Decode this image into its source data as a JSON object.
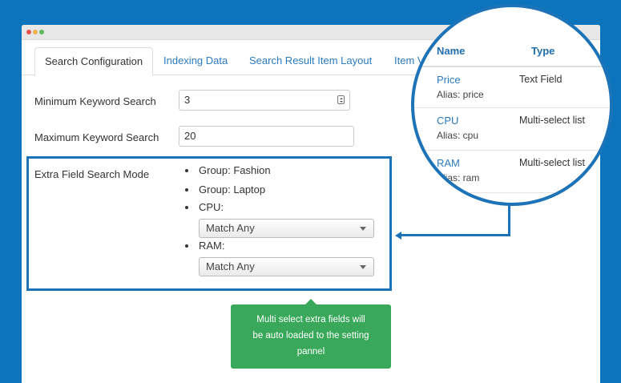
{
  "window": {
    "tabs": [
      {
        "label": "Search Configuration",
        "active": true
      },
      {
        "label": "Indexing Data",
        "active": false
      },
      {
        "label": "Search Result Item Layout",
        "active": false
      },
      {
        "label": "Item V",
        "active": false
      }
    ]
  },
  "form": {
    "min_keyword": {
      "label": "Minimum Keyword Search",
      "value": "3",
      "icon": "spinner-icon"
    },
    "max_keyword": {
      "label": "Maximum Keyword Search",
      "value": "20"
    },
    "extra_field_mode": {
      "label": "Extra Field Search Mode",
      "items": [
        {
          "text": "Group: Fashion"
        },
        {
          "text": "Group: Laptop"
        },
        {
          "text": "CPU:",
          "select": "Match Any"
        },
        {
          "text": "RAM:",
          "select": "Match Any"
        }
      ]
    }
  },
  "tooltip": {
    "text_line1": "Multi select extra fields will",
    "text_line2": "be auto loaded to the setting",
    "text_line3": "pannel",
    "color": "#3aa85a"
  },
  "magnifier": {
    "header_name": "Name",
    "header_type": "Type",
    "rows": [
      {
        "name": "Price",
        "alias": "Alias: price",
        "type": "Text Field"
      },
      {
        "name": "CPU",
        "alias": "Alias: cpu",
        "type": "Multi-select list"
      },
      {
        "name": "RAM",
        "alias": "Alias: ram",
        "type": "Multi-select list"
      }
    ]
  },
  "colors": {
    "background": "#0c74bd",
    "accent": "#1d73b7",
    "link": "#2a7bc0"
  }
}
